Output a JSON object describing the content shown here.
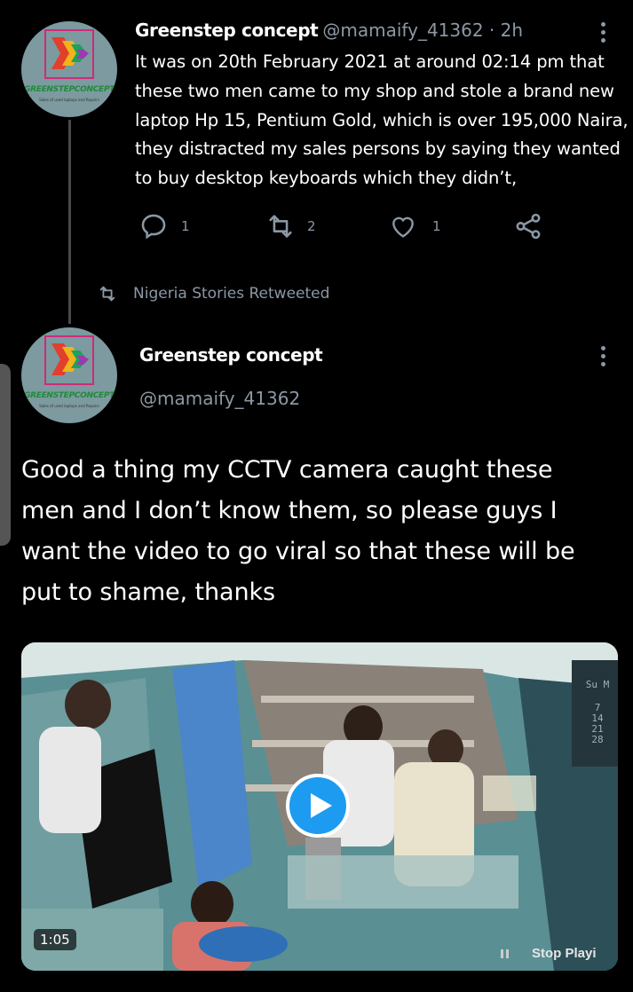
{
  "tweet1": {
    "author_name": "Greenstep concept",
    "handle_time": "@mamaify_41362 · 2h",
    "avatar_brand": "GREENSTEPCONCEPT",
    "avatar_tagline": "Sales of used laptops and Repairs",
    "text_lines": [
      "It was on 20th February 2021 at around 02:14 pm that",
      "these two men came to my shop and stole a brand new",
      "laptop Hp 15, Pentium Gold, which is over 195,000 Naira,",
      "they distracted my sales persons by saying they wanted",
      "to buy desktop keyboards which they didn’t,"
    ],
    "reply_count": "1",
    "retweet_count": "2",
    "like_count": "1"
  },
  "retweet_banner": {
    "label": "Nigeria Stories Retweeted"
  },
  "tweet2": {
    "author_name": "Greenstep concept",
    "handle": "@mamaify_41362",
    "avatar_brand": "GREENSTEPCONCEPT",
    "avatar_tagline": "Sales of used laptops and Repairs",
    "text_lines": [
      "Good a thing my CCTV camera caught these",
      "men and I don’t know them, so please guys I",
      "want the video to go viral so that these will be",
      "put to shame, thanks"
    ],
    "video": {
      "duration": "1:05",
      "overlay_label": "Stop Playi",
      "cctv_header": "Su M",
      "cctv_dates": [
        "7",
        "14",
        "21",
        "28"
      ]
    }
  },
  "colors": {
    "background": "#000000",
    "text": "#ffffff",
    "muted": "#8b98a5",
    "accent": "#1d9bf0",
    "thread_line": "#4a4a4a"
  }
}
